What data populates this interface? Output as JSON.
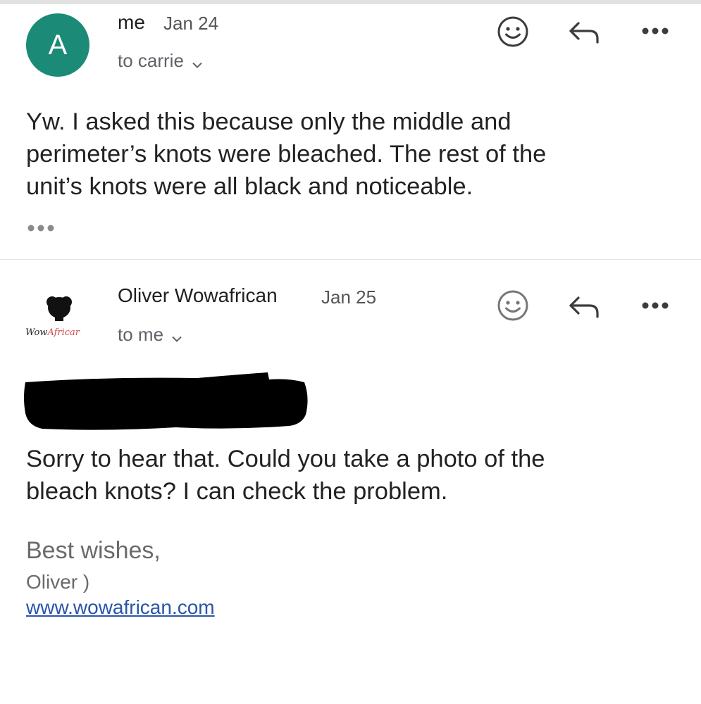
{
  "emails": [
    {
      "avatar_letter": "A",
      "sender": "me",
      "date": "Jan 24",
      "recipient": "to carrie",
      "body_lines": [
        "Yw. I asked this because only the middle  and",
        "perimeter’s knots were bleached. The rest of the",
        "unit’s knots were all black and noticeable."
      ],
      "trimmed_content": "•••"
    },
    {
      "logo_text_left": "Wow",
      "logo_text_right": "Africar",
      "sender": "Oliver Wowafrican",
      "date": "Jan 25",
      "recipient": "to me",
      "body_lines": [
        "Sorry to hear that. Could you take a photo of the",
        "bleach knots? I can check the problem."
      ],
      "signoff": "Best wishes,",
      "signature_name": "Oliver )",
      "signature_link": "www.wowafrican.com"
    }
  ],
  "colors": {
    "avatar_bg": "#1b8a77",
    "icon_gray": "#5f6368",
    "link": "#2a55a8",
    "redaction": "#000000"
  },
  "icons": [
    "emoji-reaction-icon",
    "reply-icon",
    "more-options-icon",
    "chevron-down-icon",
    "ellipsis-icon"
  ]
}
